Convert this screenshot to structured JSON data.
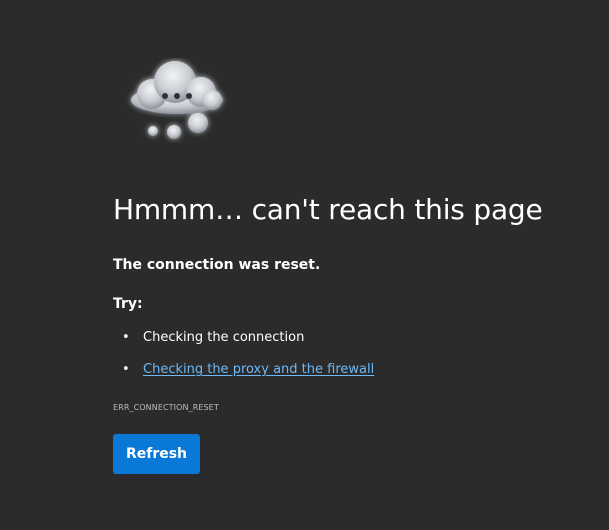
{
  "error_page": {
    "illustration_icon": "thinking-cloud-icon",
    "title": "Hmmm… can't reach this page",
    "message": "The connection was reset.",
    "try_label": "Try:",
    "suggestions": [
      {
        "text": "Checking the connection",
        "is_link": false
      },
      {
        "text": "Checking the proxy and the firewall",
        "is_link": true
      }
    ],
    "error_code": "ERR_CONNECTION_RESET",
    "refresh_label": "Refresh"
  },
  "colors": {
    "background": "#2b2b2b",
    "link": "#6db8f5",
    "button": "#0a78d7",
    "text": "#ffffff"
  }
}
